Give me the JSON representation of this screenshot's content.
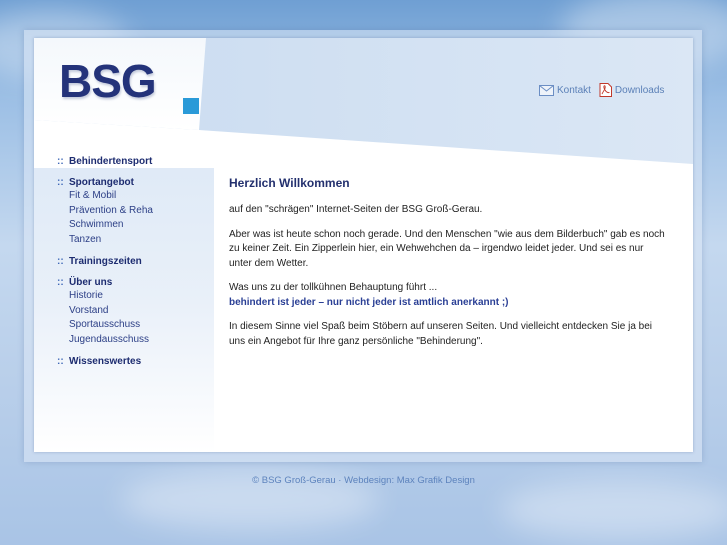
{
  "logo": {
    "text": "BSG"
  },
  "topnav": [
    {
      "label": "Kontakt",
      "icon": "envelope-icon"
    },
    {
      "label": "Downloads",
      "icon": "pdf-icon"
    }
  ],
  "sidebar": {
    "bullet": "::",
    "groups": [
      {
        "label": "Behindertensport",
        "items": []
      },
      {
        "label": "Sportangebot",
        "items": [
          "Fit & Mobil",
          "Prävention & Reha",
          "Schwimmen",
          "Tanzen"
        ]
      },
      {
        "label": "Trainingszeiten",
        "items": []
      },
      {
        "label": "Über uns",
        "items": [
          "Historie",
          "Vorstand",
          "Sportausschuss",
          "Jugendausschuss"
        ]
      },
      {
        "label": "Wissenswertes",
        "items": []
      }
    ]
  },
  "content": {
    "title": "Herzlich Willkommen",
    "p1": "auf den \"schrägen\" Internet-Seiten der BSG Groß-Gerau.",
    "p2": "Aber was ist heute schon noch gerade. Und den Menschen \"wie aus dem Bilderbuch\" gab es noch zu keiner Zeit. Ein Zipperlein hier, ein Wehwehchen da – irgendwo leidet jeder. Und sei es nur unter dem Wetter.",
    "p3a": "Was uns zu der tollkühnen Behauptung führt ...",
    "p3b": "behindert ist jeder – nur nicht jeder ist amtlich anerkannt ;)",
    "p4": "In diesem Sinne viel Spaß beim Stöbern auf unseren Seiten. Und vielleicht entdecken Sie ja bei uns ein Angebot für Ihre ganz persönliche \"Behinderung\"."
  },
  "footer": {
    "copyright": "© BSG Groß-Gerau",
    "separator": "·",
    "credit": "Webdesign: Max Grafik Design"
  },
  "colors": {
    "accent": "#2a9ad8",
    "navy": "#1d2c70",
    "link": "#5b80b7"
  }
}
